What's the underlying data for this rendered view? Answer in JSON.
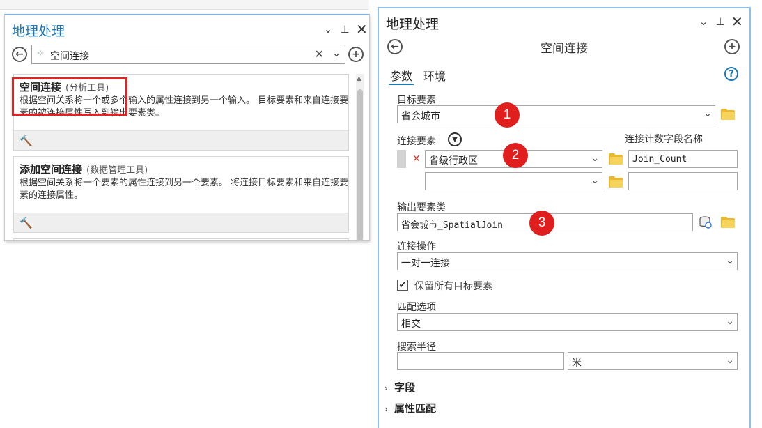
{
  "left_pane": {
    "title": "地理处理",
    "controls": {
      "dropdown": "⌄",
      "pin": "⊥",
      "close": "✕"
    },
    "search": {
      "value": "空间连接",
      "clear": "✕",
      "dropdown": "⌄"
    },
    "results": [
      {
        "name": "空间连接",
        "toolset": "(分析工具)",
        "description": "根据空间关系将一个或多个输入的属性连接到另一个输入。 目标要素和来自连接要素的被连接属性写入到输出要素类。"
      },
      {
        "name": "添加空间连接",
        "toolset": "(数据管理工具)",
        "description": "根据空间关系将一个要素的属性连接到另一个要素。 将连接目标要素和来自连接要素的连接属性。"
      }
    ],
    "highlight_color": "#e02424"
  },
  "right_pane": {
    "title": "地理处理",
    "controls": {
      "dropdown": "⌄",
      "pin": "⊥",
      "close": "✕"
    },
    "tool_title": "空间连接",
    "tabs": [
      {
        "label": "参数",
        "active": true
      },
      {
        "label": "环境",
        "active": false
      }
    ],
    "help": "?",
    "target_features": {
      "label": "目标要素",
      "value": "省会城市"
    },
    "join_features": {
      "label": "连接要素",
      "count_field_label": "连接计数字段名称",
      "rows": [
        {
          "value": "省级行政区",
          "count_field": "Join_Count"
        },
        {
          "value": "",
          "count_field": ""
        }
      ]
    },
    "output": {
      "label": "输出要素类",
      "value": "省会城市_SpatialJoin"
    },
    "join_operation": {
      "label": "连接操作",
      "value": "一对一连接"
    },
    "keep_all": {
      "label": "保留所有目标要素",
      "checked": true
    },
    "match_option": {
      "label": "匹配选项",
      "value": "相交"
    },
    "search_radius": {
      "label": "搜索半径",
      "value": "",
      "unit": "米"
    },
    "sections": [
      {
        "label": "字段"
      },
      {
        "label": "属性匹配"
      }
    ],
    "badges": [
      "1",
      "2",
      "3"
    ],
    "badge_color": "#e01e1e",
    "accent_color": "#1f78b4"
  }
}
